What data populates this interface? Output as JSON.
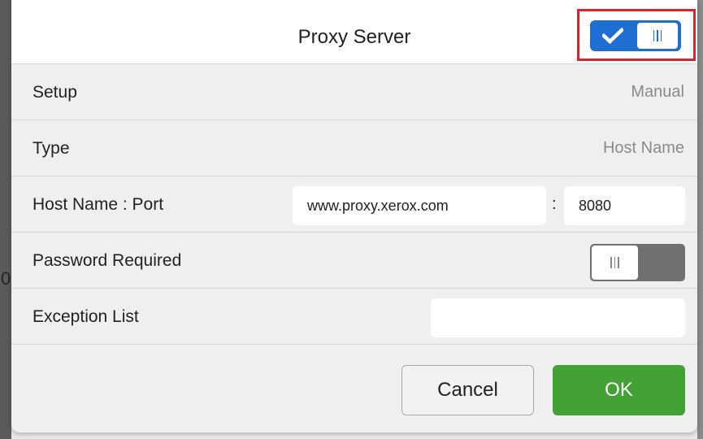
{
  "dialog": {
    "title": "Proxy Server",
    "enabled": true
  },
  "rows": {
    "setup": {
      "label": "Setup",
      "value": "Manual"
    },
    "type": {
      "label": "Type",
      "value": "Host Name"
    },
    "host_port": {
      "label": "Host Name : Port",
      "host_value": "www.proxy.xerox.com",
      "separator": ":",
      "port_value": "8080"
    },
    "password_required": {
      "label": "Password Required",
      "enabled": false
    },
    "exception_list": {
      "label": "Exception List",
      "value": ""
    }
  },
  "buttons": {
    "cancel": "Cancel",
    "ok": "OK"
  },
  "colors": {
    "toggle_on": "#1e6fd1",
    "toggle_off": "#707070",
    "ok_button": "#43a234",
    "highlight": "#e0202a"
  },
  "icons": {
    "toggle_on": "checkmark-icon",
    "toggle_grip": "grip-lines-icon"
  }
}
